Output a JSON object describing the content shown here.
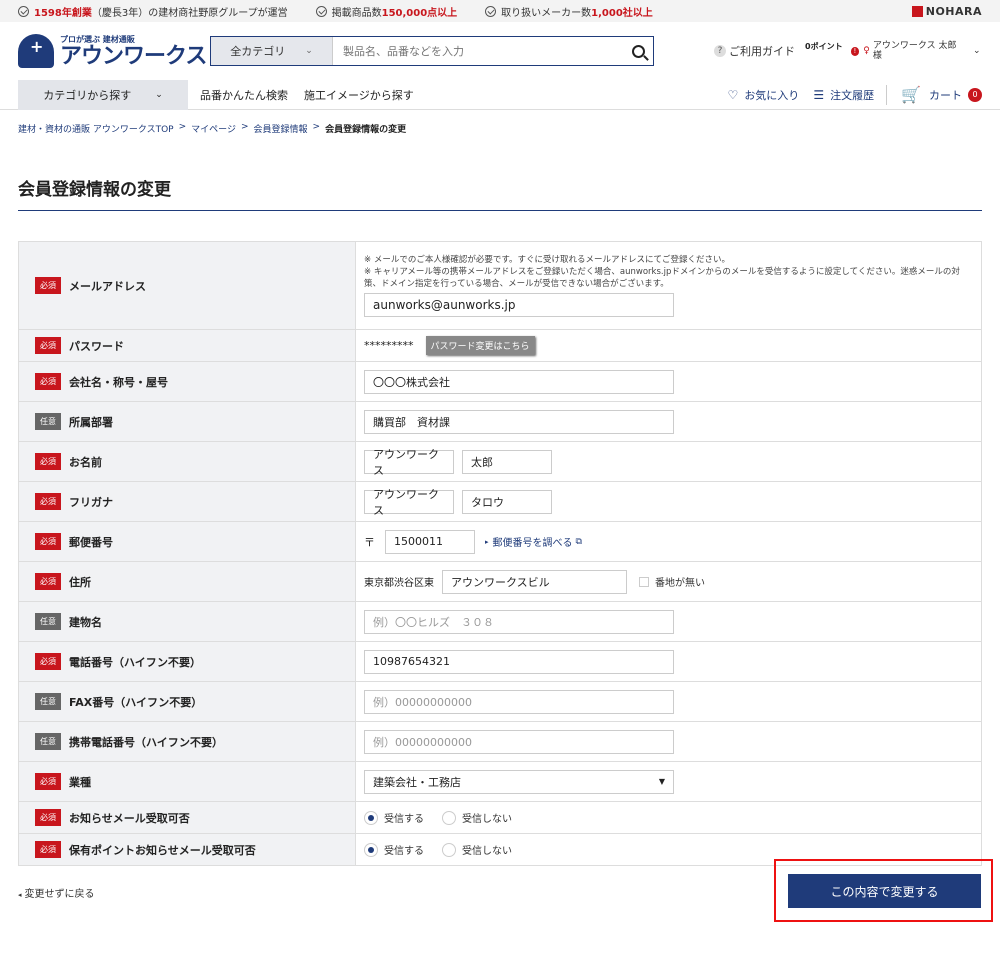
{
  "topbar": {
    "feat1_bold": "1598年創業",
    "feat1_rest": "（慶長3年）の建材商社野原グループが運営",
    "feat2_pre": "掲載商品数",
    "feat2_bold": "150,000点以上",
    "feat3_pre": "取り扱いメーカー数",
    "feat3_bold": "1,000社以上",
    "brand": "NOHARA"
  },
  "header": {
    "logo_tag": "プロが選ぶ 建材通販",
    "logo_name": "アウンワークス",
    "search_category": "全カテゴリ",
    "search_placeholder": "製品名、品番などを入力",
    "guide": "ご利用ガイド",
    "points": "0ポイント",
    "user_name": "アウンワークス 太郎 様"
  },
  "nav": {
    "category": "カテゴリから探す",
    "links": [
      "品番かんたん検索",
      "施工イメージから探す"
    ],
    "favorites": "お気に入り",
    "orders": "注文履歴",
    "cart": "カート",
    "cart_count": "0"
  },
  "breadcrumb": [
    "建材・資材の通販 アウンワークスTOP",
    "マイページ",
    "会員登録情報",
    "会員登録情報の変更"
  ],
  "page_title": "会員登録情報の変更",
  "badges": {
    "required": "必須",
    "optional": "任意"
  },
  "form": {
    "email": {
      "label": "メールアドレス",
      "note1": "※ メールでのご本人様確認が必要です。すぐに受け取れるメールアドレスにてご登録ください。",
      "note2": "※ キャリアメール等の携帯メールアドレスをご登録いただく場合、aunworks.jpドメインからのメールを受信するように設定してください。迷惑メールの対策、ドメイン指定を行っている場合、メールが受信できない場合がございます。",
      "value": "aunworks@aunworks.jp"
    },
    "password": {
      "label": "パスワード",
      "value": "*********",
      "button": "パスワード変更はこちら"
    },
    "company": {
      "label": "会社名・称号・屋号",
      "value": "〇〇〇株式会社"
    },
    "department": {
      "label": "所属部署",
      "value": "購買部　資材課"
    },
    "name": {
      "label": "お名前",
      "last": "アウンワークス",
      "first": "太郎"
    },
    "kana": {
      "label": "フリガナ",
      "last": "アウンワークス",
      "first": "タロウ"
    },
    "zip": {
      "label": "郵便番号",
      "symbol": "〒",
      "value": "1500011",
      "link": "郵便番号を調べる"
    },
    "address": {
      "label": "住所",
      "prefix": "東京都渋谷区東",
      "value": "アウンワークスビル",
      "no_number": "番地が無い"
    },
    "building": {
      "label": "建物名",
      "placeholder": "例）〇〇ヒルズ　３０８"
    },
    "phone": {
      "label": "電話番号（ハイフン不要）",
      "value": "10987654321"
    },
    "fax": {
      "label": "FAX番号（ハイフン不要）",
      "placeholder": "例）00000000000"
    },
    "mobile": {
      "label": "携帯電話番号（ハイフン不要）",
      "placeholder": "例）00000000000"
    },
    "industry": {
      "label": "業種",
      "value": "建築会社・工務店"
    },
    "news_mail": {
      "label": "お知らせメール受取可否",
      "yes": "受信する",
      "no": "受信しない"
    },
    "points_mail": {
      "label": "保有ポイントお知らせメール受取可否",
      "yes": "受信する",
      "no": "受信しない"
    }
  },
  "actions": {
    "back": "変更せずに戻る",
    "submit": "この内容で変更する"
  }
}
